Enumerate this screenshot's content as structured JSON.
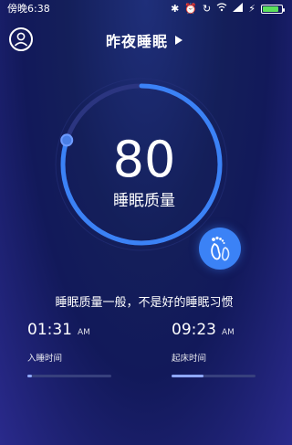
{
  "status_bar": {
    "time": "傍晚6:38",
    "icons": [
      "bluetooth-icon",
      "alarm-icon",
      "sync-icon",
      "wifi-icon",
      "signal-icon",
      "charging-icon",
      "battery-icon"
    ],
    "battery_level": 0.85,
    "battery_color": "#5be05b"
  },
  "header": {
    "title": "昨夜睡眠"
  },
  "score": {
    "value": "80",
    "label": "睡眠质量",
    "progress_fraction": 0.8,
    "ring_color": "#3b82f6",
    "track_color": "#2b3580"
  },
  "advice": "睡眠质量一般，不是好的睡眠习惯",
  "sleep": {
    "time": "01:31",
    "ampm": "AM",
    "label": "入睡时间",
    "progress_fraction": 0.05
  },
  "wake": {
    "time": "09:23",
    "ampm": "AM",
    "label": "起床时间",
    "progress_fraction": 0.38
  }
}
